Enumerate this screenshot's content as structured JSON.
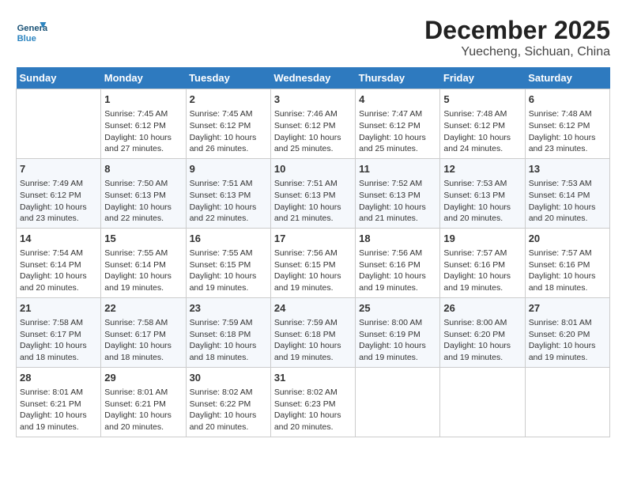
{
  "header": {
    "logo_general": "General",
    "logo_blue": "Blue",
    "month_year": "December 2025",
    "location": "Yuecheng, Sichuan, China"
  },
  "days_of_week": [
    "Sunday",
    "Monday",
    "Tuesday",
    "Wednesday",
    "Thursday",
    "Friday",
    "Saturday"
  ],
  "weeks": [
    [
      {
        "day": "",
        "info": ""
      },
      {
        "day": "1",
        "info": "Sunrise: 7:45 AM\nSunset: 6:12 PM\nDaylight: 10 hours\nand 27 minutes."
      },
      {
        "day": "2",
        "info": "Sunrise: 7:45 AM\nSunset: 6:12 PM\nDaylight: 10 hours\nand 26 minutes."
      },
      {
        "day": "3",
        "info": "Sunrise: 7:46 AM\nSunset: 6:12 PM\nDaylight: 10 hours\nand 25 minutes."
      },
      {
        "day": "4",
        "info": "Sunrise: 7:47 AM\nSunset: 6:12 PM\nDaylight: 10 hours\nand 25 minutes."
      },
      {
        "day": "5",
        "info": "Sunrise: 7:48 AM\nSunset: 6:12 PM\nDaylight: 10 hours\nand 24 minutes."
      },
      {
        "day": "6",
        "info": "Sunrise: 7:48 AM\nSunset: 6:12 PM\nDaylight: 10 hours\nand 23 minutes."
      }
    ],
    [
      {
        "day": "7",
        "info": "Sunrise: 7:49 AM\nSunset: 6:12 PM\nDaylight: 10 hours\nand 23 minutes."
      },
      {
        "day": "8",
        "info": "Sunrise: 7:50 AM\nSunset: 6:13 PM\nDaylight: 10 hours\nand 22 minutes."
      },
      {
        "day": "9",
        "info": "Sunrise: 7:51 AM\nSunset: 6:13 PM\nDaylight: 10 hours\nand 22 minutes."
      },
      {
        "day": "10",
        "info": "Sunrise: 7:51 AM\nSunset: 6:13 PM\nDaylight: 10 hours\nand 21 minutes."
      },
      {
        "day": "11",
        "info": "Sunrise: 7:52 AM\nSunset: 6:13 PM\nDaylight: 10 hours\nand 21 minutes."
      },
      {
        "day": "12",
        "info": "Sunrise: 7:53 AM\nSunset: 6:13 PM\nDaylight: 10 hours\nand 20 minutes."
      },
      {
        "day": "13",
        "info": "Sunrise: 7:53 AM\nSunset: 6:14 PM\nDaylight: 10 hours\nand 20 minutes."
      }
    ],
    [
      {
        "day": "14",
        "info": "Sunrise: 7:54 AM\nSunset: 6:14 PM\nDaylight: 10 hours\nand 20 minutes."
      },
      {
        "day": "15",
        "info": "Sunrise: 7:55 AM\nSunset: 6:14 PM\nDaylight: 10 hours\nand 19 minutes."
      },
      {
        "day": "16",
        "info": "Sunrise: 7:55 AM\nSunset: 6:15 PM\nDaylight: 10 hours\nand 19 minutes."
      },
      {
        "day": "17",
        "info": "Sunrise: 7:56 AM\nSunset: 6:15 PM\nDaylight: 10 hours\nand 19 minutes."
      },
      {
        "day": "18",
        "info": "Sunrise: 7:56 AM\nSunset: 6:16 PM\nDaylight: 10 hours\nand 19 minutes."
      },
      {
        "day": "19",
        "info": "Sunrise: 7:57 AM\nSunset: 6:16 PM\nDaylight: 10 hours\nand 19 minutes."
      },
      {
        "day": "20",
        "info": "Sunrise: 7:57 AM\nSunset: 6:16 PM\nDaylight: 10 hours\nand 18 minutes."
      }
    ],
    [
      {
        "day": "21",
        "info": "Sunrise: 7:58 AM\nSunset: 6:17 PM\nDaylight: 10 hours\nand 18 minutes."
      },
      {
        "day": "22",
        "info": "Sunrise: 7:58 AM\nSunset: 6:17 PM\nDaylight: 10 hours\nand 18 minutes."
      },
      {
        "day": "23",
        "info": "Sunrise: 7:59 AM\nSunset: 6:18 PM\nDaylight: 10 hours\nand 18 minutes."
      },
      {
        "day": "24",
        "info": "Sunrise: 7:59 AM\nSunset: 6:18 PM\nDaylight: 10 hours\nand 19 minutes."
      },
      {
        "day": "25",
        "info": "Sunrise: 8:00 AM\nSunset: 6:19 PM\nDaylight: 10 hours\nand 19 minutes."
      },
      {
        "day": "26",
        "info": "Sunrise: 8:00 AM\nSunset: 6:20 PM\nDaylight: 10 hours\nand 19 minutes."
      },
      {
        "day": "27",
        "info": "Sunrise: 8:01 AM\nSunset: 6:20 PM\nDaylight: 10 hours\nand 19 minutes."
      }
    ],
    [
      {
        "day": "28",
        "info": "Sunrise: 8:01 AM\nSunset: 6:21 PM\nDaylight: 10 hours\nand 19 minutes."
      },
      {
        "day": "29",
        "info": "Sunrise: 8:01 AM\nSunset: 6:21 PM\nDaylight: 10 hours\nand 20 minutes."
      },
      {
        "day": "30",
        "info": "Sunrise: 8:02 AM\nSunset: 6:22 PM\nDaylight: 10 hours\nand 20 minutes."
      },
      {
        "day": "31",
        "info": "Sunrise: 8:02 AM\nSunset: 6:23 PM\nDaylight: 10 hours\nand 20 minutes."
      },
      {
        "day": "",
        "info": ""
      },
      {
        "day": "",
        "info": ""
      },
      {
        "day": "",
        "info": ""
      }
    ]
  ]
}
